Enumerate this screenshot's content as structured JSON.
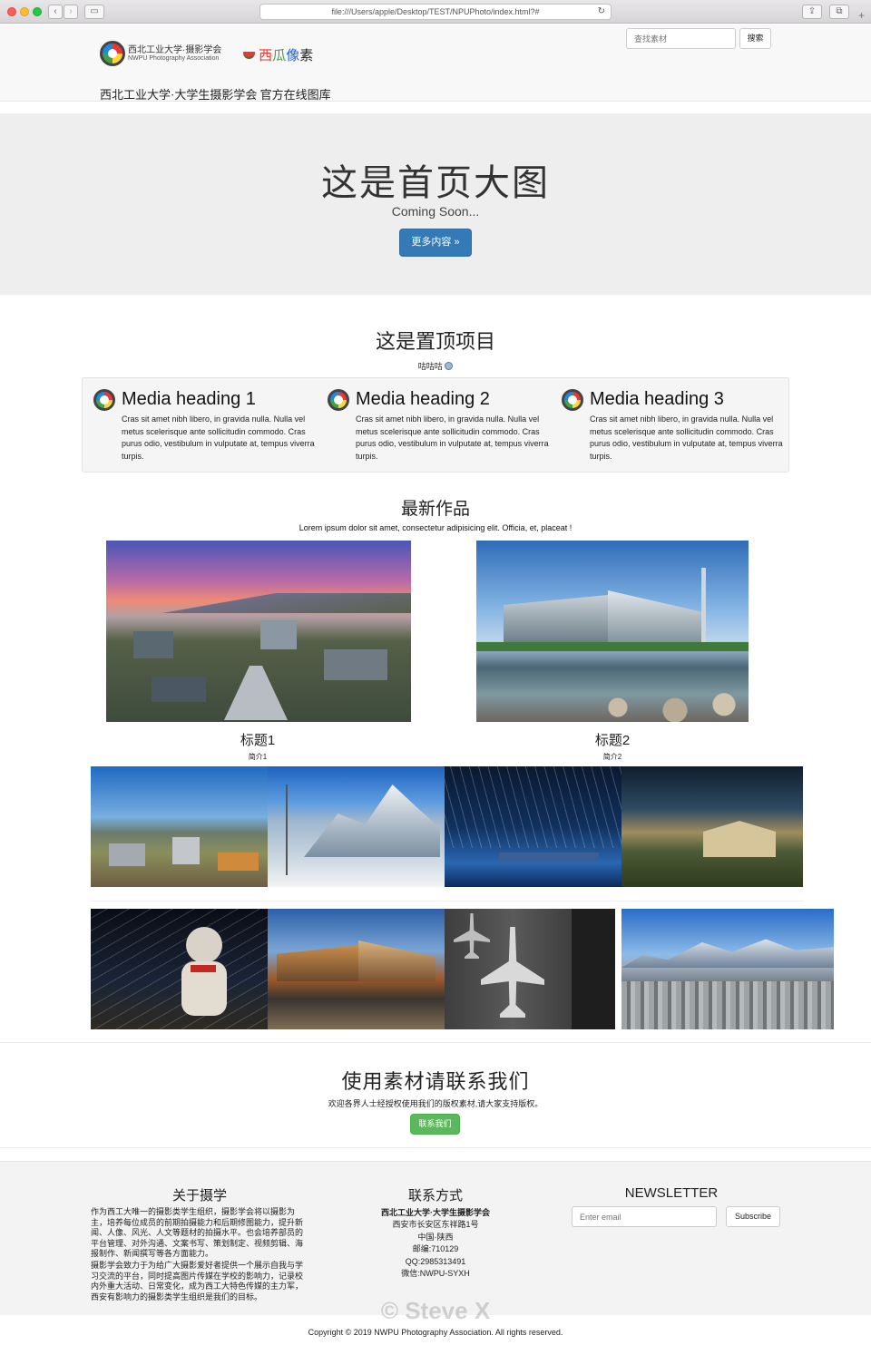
{
  "browser": {
    "url": "file:///Users/apple/Desktop/TEST/NPUPhoto/index.html?#"
  },
  "header": {
    "org_name": "西北工业大学·摄影学会",
    "org_name_en": "NWPU Photography Association",
    "brand_xi": "西",
    "brand_gua": "瓜",
    "brand_xiang": "像",
    "brand_su": "素",
    "tagline": "西北工业大学·大学生摄影学会 官方在线图库",
    "search_placeholder": "查找素材",
    "search_button": "搜索"
  },
  "hero": {
    "title": "这是首页大图",
    "subtitle": "Coming Soon...",
    "button": "更多内容 »"
  },
  "featured": {
    "title": "这是置顶项目",
    "subtitle": "咕咕咕",
    "items": [
      {
        "heading": "Media heading 1",
        "body": "Cras sit amet nibh libero, in gravida nulla. Nulla vel metus scelerisque ante sollicitudin commodo. Cras purus odio, vestibulum in vulputate at, tempus viverra turpis."
      },
      {
        "heading": "Media heading 2",
        "body": "Cras sit amet nibh libero, in gravida nulla. Nulla vel metus scelerisque ante sollicitudin commodo. Cras purus odio, vestibulum in vulputate at, tempus viverra turpis."
      },
      {
        "heading": "Media heading 3",
        "body": "Cras sit amet nibh libero, in gravida nulla. Nulla vel metus scelerisque ante sollicitudin commodo. Cras purus odio, vestibulum in vulputate at, tempus viverra turpis."
      }
    ]
  },
  "latest": {
    "title": "最新作品",
    "subtitle": "Lorem ipsum dolor sit amet, consectetur adipisicing elit. Officia, et, placeat !",
    "cards": [
      {
        "title": "标题1",
        "desc": "简介1"
      },
      {
        "title": "标题2",
        "desc": "简介2"
      }
    ]
  },
  "contact_cta": {
    "title": "使用素材请联系我们",
    "subtitle": "欢迎各界人士经授权使用我们的版权素材,请大家支持版权。",
    "button": "联系我们"
  },
  "footer": {
    "about_title": "关于摄学",
    "about_p1": "作为西工大唯一的摄影类学生组织，摄影学会将以摄影为主，培养每位成员的前期拍摄能力和后期修图能力，提升新闻、人像、风光、人文等题材的拍摄水平。也会培养部员的平台管理、对外沟通、文案书写、策划制定、视频剪辑、海报制作、新闻撰写等各方面能力。",
    "about_p2": "摄影学会致力于为给广大摄影爱好者提供一个展示自我与学习交流的平台，同时提高图片传媒在学校的影响力，记录校内外重大活动、日常变化，成为西工大特色传媒的主力军，西安有影响力的摄影类学生组织是我们的目标。",
    "contact_title": "联系方式",
    "contact_lines": [
      "西北工业大学·大学生摄影学会",
      "西安市长安区东祥路1号",
      "中国·陕西",
      "邮编:710129",
      "QQ:2985313491",
      "微信:NWPU-SYXH"
    ],
    "newsletter_title": "NEWSLETTER",
    "email_placeholder": "Enter email",
    "subscribe": "Subscribe",
    "copyright": "Copyright © 2019 NWPU Photography Association. All rights reserved.",
    "watermark": "© Steve X"
  },
  "colors": {
    "primary": "#337ab7",
    "success": "#5cb85c"
  }
}
